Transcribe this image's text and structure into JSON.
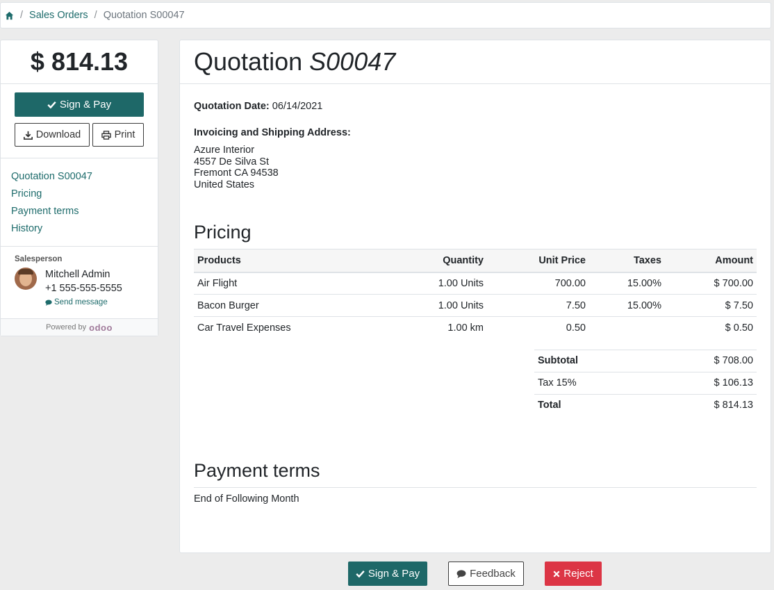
{
  "breadcrumb": {
    "home_icon": "home-icon",
    "items": [
      "Sales Orders",
      "Quotation S00047"
    ]
  },
  "sidebar": {
    "amount": "$ 814.13",
    "sign_pay_label": "Sign & Pay",
    "download_label": "Download",
    "print_label": "Print",
    "nav": [
      "Quotation S00047",
      "Pricing",
      "Payment terms",
      "History"
    ],
    "salesperson_title": "Salesperson",
    "salesperson_name": "Mitchell Admin",
    "salesperson_phone": "+1 555-555-5555",
    "send_message_label": "Send message",
    "powered_by": "Powered by",
    "powered_logo": "odoo"
  },
  "main": {
    "title_prefix": "Quotation",
    "title_number": "S00047",
    "quotation_date_label": "Quotation Date:",
    "quotation_date": "06/14/2021",
    "address_title": "Invoicing and Shipping Address:",
    "address_lines": [
      "Azure Interior",
      "4557 De Silva St",
      "Fremont CA 94538",
      "United States"
    ],
    "pricing_title": "Pricing",
    "table_headers": [
      "Products",
      "Quantity",
      "Unit Price",
      "Taxes",
      "Amount"
    ],
    "rows": [
      {
        "product": "Air Flight",
        "quantity": "1.00 Units",
        "unit_price": "700.00",
        "taxes": "15.00%",
        "amount": "$ 700.00"
      },
      {
        "product": "Bacon Burger",
        "quantity": "1.00 Units",
        "unit_price": "7.50",
        "taxes": "15.00%",
        "amount": "$ 7.50"
      },
      {
        "product": "Car Travel Expenses",
        "quantity": "1.00 km",
        "unit_price": "0.50",
        "taxes": "",
        "amount": "$ 0.50"
      }
    ],
    "totals": {
      "subtotal_label": "Subtotal",
      "subtotal": "$ 708.00",
      "tax_label": "Tax 15%",
      "tax": "$ 106.13",
      "total_label": "Total",
      "total": "$ 814.13"
    },
    "payment_terms_title": "Payment terms",
    "payment_terms_text": "End of Following Month"
  },
  "footer": {
    "sign_pay_label": "Sign & Pay",
    "feedback_label": "Feedback",
    "reject_label": "Reject"
  },
  "colors": {
    "primary": "#1e6868",
    "link": "#1d6b6b",
    "danger": "#dc3545",
    "background": "#ececec"
  }
}
